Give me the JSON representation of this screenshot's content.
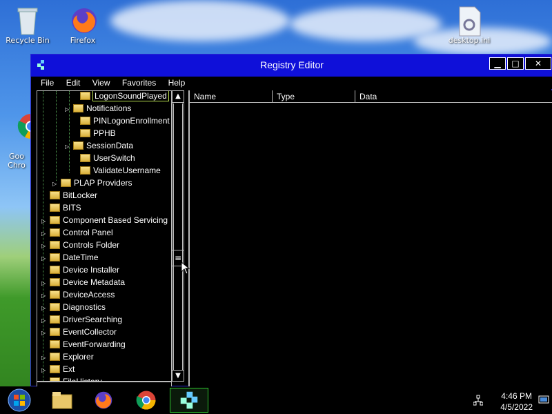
{
  "desktop": {
    "icons": [
      {
        "label": "Recycle Bin"
      },
      {
        "label": "Firefox"
      },
      {
        "label": "desktop.ini"
      },
      {
        "label": "Goo\nChro"
      }
    ]
  },
  "window": {
    "title": "Registry Editor",
    "menu": [
      "File",
      "Edit",
      "View",
      "Favorites",
      "Help"
    ],
    "controls": {
      "minimize": "▁",
      "maximize": "□",
      "close": "✕"
    }
  },
  "tree": {
    "items": [
      {
        "label": "LogonSoundPlayed",
        "selected": true,
        "expander": false
      },
      {
        "label": "Notifications",
        "expander": true
      },
      {
        "label": "PINLogonEnrollment",
        "expander": false
      },
      {
        "label": "PPHB",
        "expander": false
      },
      {
        "label": "SessionData",
        "expander": true
      },
      {
        "label": "UserSwitch",
        "expander": false
      },
      {
        "label": "ValidateUsername",
        "expander": false
      },
      {
        "label": "PLAP Providers",
        "expander": true
      },
      {
        "label": "BitLocker",
        "expander": false
      },
      {
        "label": "BITS",
        "expander": false
      },
      {
        "label": "Component Based Servicing",
        "expander": true
      },
      {
        "label": "Control Panel",
        "expander": true
      },
      {
        "label": "Controls Folder",
        "expander": true
      },
      {
        "label": "DateTime",
        "expander": true
      },
      {
        "label": "Device Installer",
        "expander": false
      },
      {
        "label": "Device Metadata",
        "expander": true
      },
      {
        "label": "DeviceAccess",
        "expander": true
      },
      {
        "label": "Diagnostics",
        "expander": true
      },
      {
        "label": "DriverSearching",
        "expander": true
      },
      {
        "label": "EventCollector",
        "expander": true
      },
      {
        "label": "EventForwarding",
        "expander": false
      },
      {
        "label": "Explorer",
        "expander": true
      },
      {
        "label": "Ext",
        "expander": true
      },
      {
        "label": "FileHistory",
        "expander": true
      }
    ]
  },
  "list": {
    "columns": [
      "Name",
      "Type",
      "Data"
    ]
  },
  "taskbar": {
    "apps": [
      "start-orb",
      "file-explorer",
      "firefox",
      "chrome",
      "registry-editor"
    ],
    "time": "4:46 PM",
    "date": "4/5/2022"
  }
}
